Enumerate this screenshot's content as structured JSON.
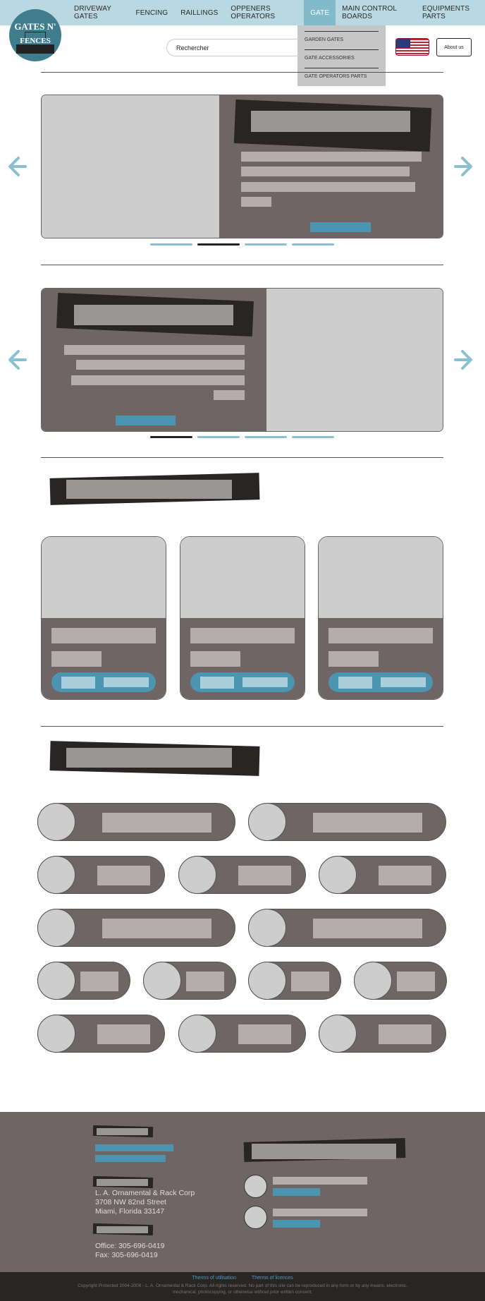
{
  "nav": {
    "items": [
      {
        "label": "DRIVEWAY GATES"
      },
      {
        "label": "FENCING"
      },
      {
        "label": "RAILLINGS"
      },
      {
        "label": "OPPENERS OPERATORS"
      },
      {
        "label": "GATE"
      },
      {
        "label": "MAIN CONTROL BOARDS"
      },
      {
        "label": "EQUIPMENTS PARTS"
      }
    ],
    "active": "GATE"
  },
  "logo": {
    "line1": "GATES N'",
    "line2": "FENCES"
  },
  "dropdown": {
    "items": [
      "GARDEN GATES",
      "GATE ACCESSORIES",
      "GATE OPERATORS PARTS"
    ]
  },
  "search": {
    "placeholder": "Rechercher"
  },
  "flag_icon": "us-flag-icon",
  "about": {
    "label": "About us"
  },
  "footer": {
    "address": [
      "L. A. Ornamental & Rack Corp",
      "3708 NW 82nd Street",
      "Miami, Florida 33147"
    ],
    "phones": [
      "Office: 305-696-0419",
      "Fax: 305-696-0419"
    ],
    "links": [
      "Therms of utilisation",
      "Therms of licences"
    ],
    "copyright": "Copyright Protected 2004-2008 - L. A. Ornamental & Rack Corp.  All rights reserved. No part of this site can be reproduced in any form or by any means, electronic, mechanical, photocopying, or otherwise without prior written consent."
  },
  "colors": {
    "accent": "#4b95b1",
    "topbar": "#b9d8e2",
    "dark": "#6f6565",
    "footer_bottom": "#2a2525"
  }
}
